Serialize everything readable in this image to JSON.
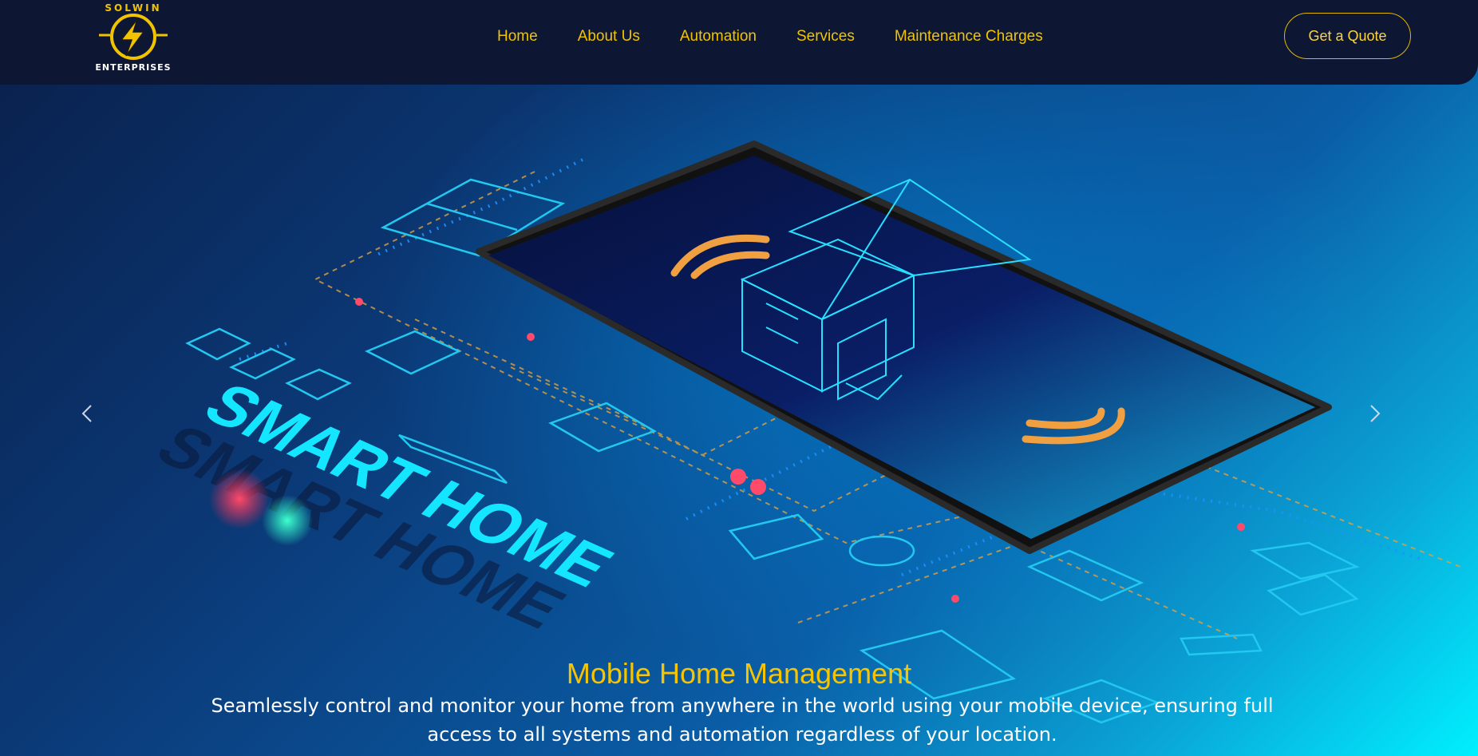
{
  "brand": {
    "logo_top_text": "SOLWIN",
    "logo_bottom_text": "ENTERPRISES"
  },
  "nav": {
    "items": [
      {
        "label": "Home"
      },
      {
        "label": "About Us"
      },
      {
        "label": "Automation"
      },
      {
        "label": "Services"
      },
      {
        "label": "Maintenance Charges"
      }
    ],
    "cta_label": "Get a Quote"
  },
  "hero": {
    "artwork_text": "SMART HOME",
    "caption_title": "Mobile Home Management",
    "caption_text": "Seamlessly control and monitor your home from anywhere in the world using your mobile device, ensuring full access to all systems and automation regardless of your location."
  },
  "carousel": {
    "prev_icon": "chevron-left-icon",
    "next_icon": "chevron-right-icon"
  },
  "colors": {
    "header_bg": "#0d1733",
    "accent_yellow": "#f2c300",
    "cyan_glow": "#22d8ff"
  }
}
